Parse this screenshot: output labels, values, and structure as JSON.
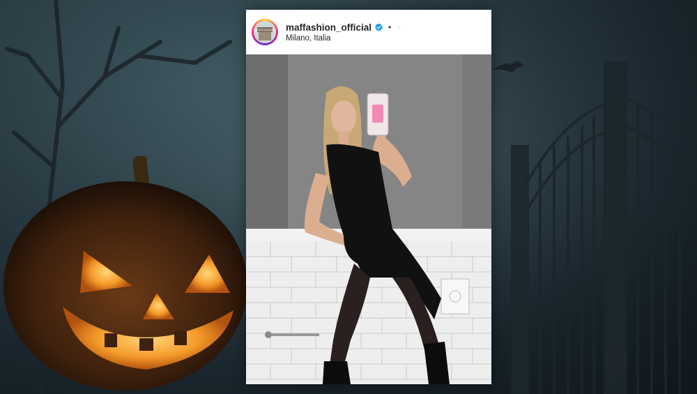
{
  "post": {
    "username": "maffashion_official",
    "separator": "•",
    "more_indicator": "·",
    "location": "Milano, Italia",
    "avatar_label": "MAFFASHION",
    "verified": true
  },
  "icons": {
    "verified": "verified-badge-icon",
    "avatar": "profile-avatar-icon"
  },
  "colors": {
    "accent_verified": "#1d9bf0",
    "pumpkin_glow": "#f59a2a",
    "background_mist": "#2f444c"
  }
}
